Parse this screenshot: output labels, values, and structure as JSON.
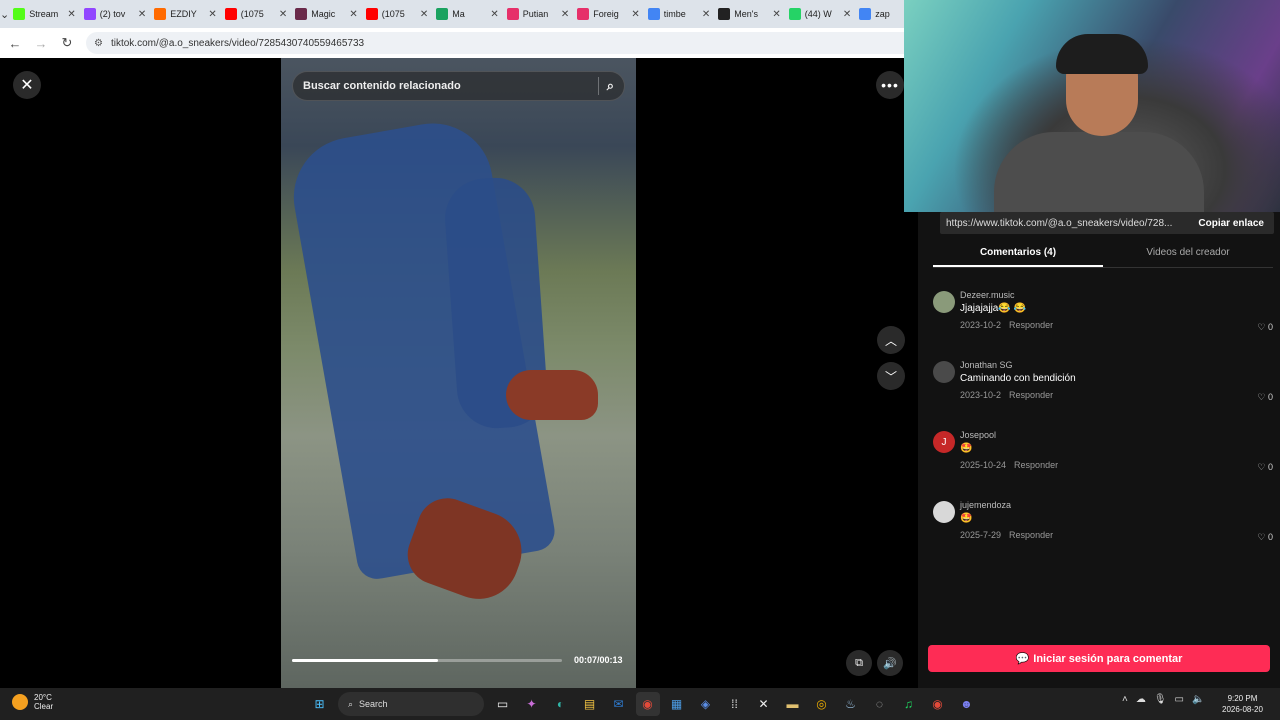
{
  "browser": {
    "tabs": [
      {
        "title": "Stream",
        "icon": "kick-icon",
        "color": "#53fc18"
      },
      {
        "title": "(2) tov",
        "icon": "twitch-icon",
        "color": "#9146ff"
      },
      {
        "title": "EZDIY",
        "icon": "ezdiy-icon",
        "color": "#ff6a00"
      },
      {
        "title": "(1075",
        "icon": "youtube-icon",
        "color": "#ff0000"
      },
      {
        "title": "Magic",
        "icon": "magic-icon",
        "color": "#6a2a4a"
      },
      {
        "title": "(1075",
        "icon": "youtube-icon",
        "color": "#ff0000"
      },
      {
        "title": "Ma",
        "icon": "sheets-icon",
        "color": "#1aa260"
      },
      {
        "title": "Putian",
        "icon": "shop-icon",
        "color": "#e6306a"
      },
      {
        "title": "Foreig",
        "icon": "shop-icon",
        "color": "#e6306a"
      },
      {
        "title": "timbe",
        "icon": "google-icon",
        "color": "#4285f4"
      },
      {
        "title": "Men's",
        "icon": "alien-icon",
        "color": "#222222"
      },
      {
        "title": "(44) W",
        "icon": "whatsapp-icon",
        "color": "#25d366"
      },
      {
        "title": "zap",
        "icon": "google-icon",
        "color": "#4285f4"
      }
    ],
    "url": "tiktok.com/@a.o_sneakers/video/7285430740559465733"
  },
  "video": {
    "search_placeholder": "Buscar contenido relacionado",
    "time": "00:07/00:13",
    "progress_fraction": 0.54
  },
  "panel": {
    "link_url": "https://www.tiktok.com/@a.o_sneakers/video/728...",
    "copy_label": "Copiar enlace",
    "tab_comments": "Comentarios (4)",
    "tab_creator": "Videos del creador",
    "comments": [
      {
        "user": "Dezeer.music",
        "text": "Jjajajajja😂 😂",
        "date": "2023-10-2",
        "reply": "Responder",
        "likes": "0",
        "avatar": "",
        "avatar_color": "#8a9a7a"
      },
      {
        "user": "Jonathan SG",
        "text": "Caminando con bendición",
        "date": "2023-10-2",
        "reply": "Responder",
        "likes": "0",
        "avatar": "",
        "avatar_color": "#4a4a4a"
      },
      {
        "user": "Josepool",
        "text": "🤩",
        "date": "2025-10-24",
        "reply": "Responder",
        "likes": "0",
        "avatar": "J",
        "avatar_color": "#c62828"
      },
      {
        "user": "jujemendoza",
        "text": "🤩",
        "date": "2025-7-29",
        "reply": "Responder",
        "likes": "0",
        "avatar": "",
        "avatar_color": "#d8d8d8"
      }
    ],
    "login_label": "Iniciar sesión para comentar"
  },
  "taskbar": {
    "weather_temp": "20°C",
    "weather_desc": "Clear",
    "search_label": "Search",
    "time": "9:20 PM",
    "date": "2026-08-20"
  }
}
